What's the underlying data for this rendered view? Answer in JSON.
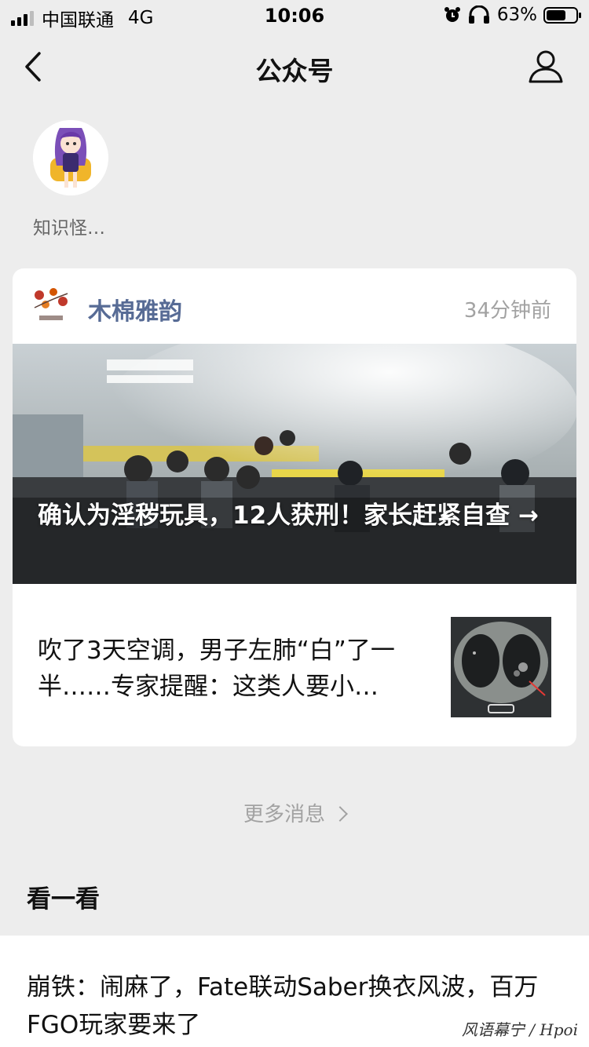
{
  "status_bar": {
    "carrier": "中国联通",
    "network": "4G",
    "time": "10:06",
    "battery_percent": "63%"
  },
  "nav": {
    "title": "公众号",
    "back_icon": "chevron-left-icon",
    "profile_icon": "user-icon"
  },
  "top_account": {
    "name": "知识怪…"
  },
  "message_card": {
    "source": "木棉雅韵",
    "time_ago": "34分钟前",
    "headline": "确认为淫秽玩具，12人获刑！家长赶紧自查 →",
    "sub_article_title": "吹了3天空调，男子左肺“白”了一半……专家提醒：这类人要小…"
  },
  "more_messages": "更多消息",
  "section": {
    "title": "看一看",
    "article_title": "崩铁：闹麻了，Fate联动Saber换衣风波，百万FGO玩家要来了"
  },
  "watermark": "风语幕宁 / Hpoi",
  "colors": {
    "background": "#ededed",
    "source_link": "#576b95",
    "muted_text": "#a2a2a2"
  }
}
